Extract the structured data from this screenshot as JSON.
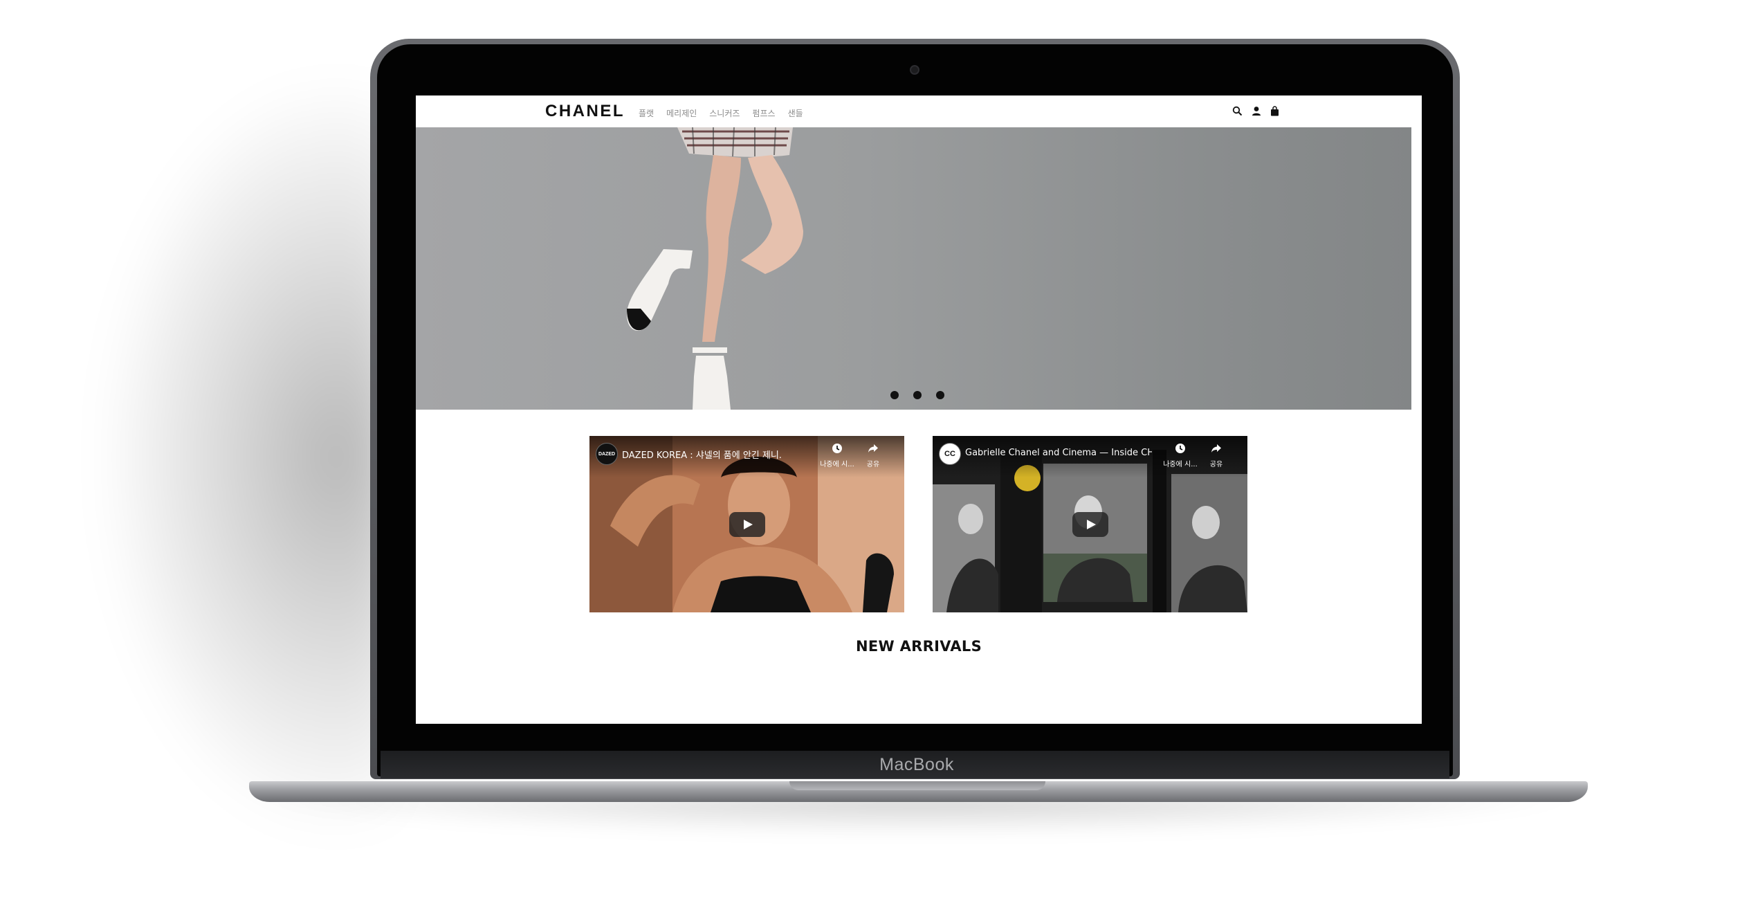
{
  "device": {
    "label": "MacBook"
  },
  "site": {
    "logo": "CHANEL",
    "nav": {
      "links": [
        "플랫",
        "메리제인",
        "스니커즈",
        "펌프스",
        "샌들"
      ],
      "icons": [
        "search-icon",
        "user-icon",
        "shopping-bag-icon"
      ]
    },
    "hero": {
      "slides_count": 3,
      "slide_dots": [
        "",
        "",
        ""
      ]
    },
    "videos": [
      {
        "channel_badge": "DAZED",
        "title": "DAZED KOREA : 샤넬의 품에 안긴 제니.",
        "watch_later": "나중에 시...",
        "share": "공유"
      },
      {
        "channel_badge": "CC",
        "title": "Gabrielle Chanel and Cinema — Inside CHA...",
        "watch_later": "나중에 시...",
        "share": "공유"
      }
    ],
    "section_title": "NEW ARRIVALS"
  },
  "colors": {
    "accent": "#111111",
    "nav_link": "#8a8a8a",
    "hero_bg": "#9b9d9e"
  }
}
